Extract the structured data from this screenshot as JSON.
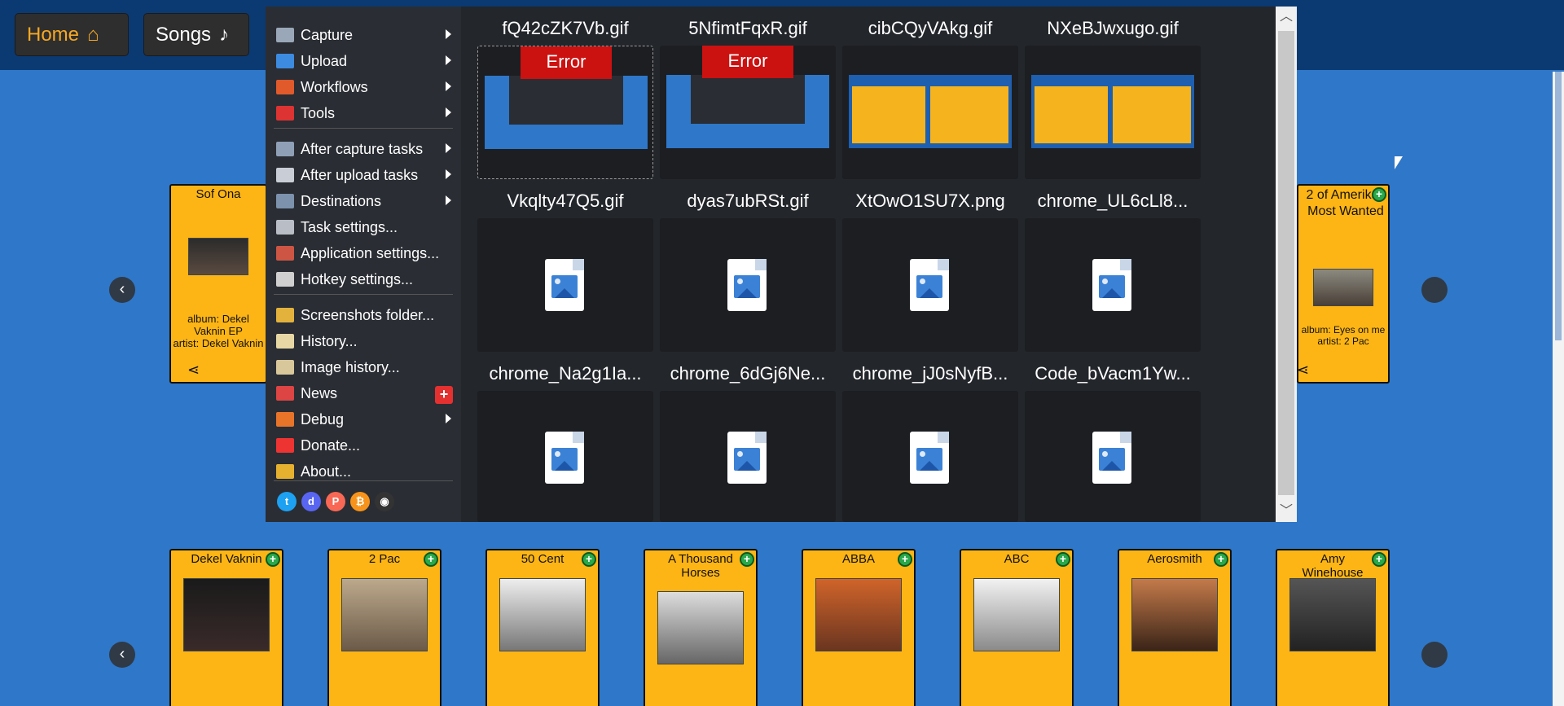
{
  "nav": {
    "home_label": "Home",
    "songs_label": "Songs",
    "home_icon": "home-icon",
    "songs_icon": "music-note-icon"
  },
  "row1": [
    {
      "title": "Sof Ona",
      "album": "album:  Dekel Vaknin EP",
      "artist": "artist: Dekel Vaknin"
    },
    {
      "title": "2 of Amerikaz Most Wanted",
      "album": "album:  Eyes on me",
      "artist": "artist: 2 Pac"
    }
  ],
  "row2": [
    {
      "title": "Dekel Vaknin"
    },
    {
      "title": "2 Pac"
    },
    {
      "title": "50 Cent"
    },
    {
      "title": "A Thousand Horses"
    },
    {
      "title": "ABBA"
    },
    {
      "title": "ABC"
    },
    {
      "title": "Aerosmith"
    },
    {
      "title": "Amy Winehouse"
    }
  ],
  "menu": [
    {
      "label": "Capture",
      "icon": "capture-icon",
      "color": "#9aa7b8",
      "submenu": true
    },
    {
      "label": "Upload",
      "icon": "upload-icon",
      "color": "#3d8be0",
      "submenu": true
    },
    {
      "label": "Workflows",
      "icon": "workflows-icon",
      "color": "#e05a2b",
      "submenu": true
    },
    {
      "label": "Tools",
      "icon": "tools-icon",
      "color": "#d33",
      "submenu": true
    },
    {
      "label": "After capture tasks",
      "icon": "after-capture-icon",
      "color": "#8fa0b6",
      "submenu": true
    },
    {
      "label": "After upload tasks",
      "icon": "after-upload-icon",
      "color": "#c9ced6",
      "submenu": true
    },
    {
      "label": "Destinations",
      "icon": "destinations-icon",
      "color": "#7c92ad",
      "submenu": true
    },
    {
      "label": "Task settings...",
      "icon": "gear-icon",
      "color": "#b9bec6",
      "submenu": false
    },
    {
      "label": "Application settings...",
      "icon": "wrench-icon",
      "color": "#c54",
      "submenu": false
    },
    {
      "label": "Hotkey settings...",
      "icon": "keyboard-icon",
      "color": "#d0d0d0",
      "submenu": false
    },
    {
      "label": "Screenshots folder...",
      "icon": "folder-icon",
      "color": "#e3b23c",
      "submenu": false
    },
    {
      "label": "History...",
      "icon": "history-icon",
      "color": "#e7d7a5",
      "submenu": false
    },
    {
      "label": "Image history...",
      "icon": "image-history-icon",
      "color": "#d8c79a",
      "submenu": false
    },
    {
      "label": "News",
      "icon": "megaphone-icon",
      "color": "#d44",
      "submenu": false
    },
    {
      "label": "Debug",
      "icon": "cone-icon",
      "color": "#e8742a",
      "submenu": true
    },
    {
      "label": "Donate...",
      "icon": "heart-icon",
      "color": "#e33",
      "submenu": false
    },
    {
      "label": "About...",
      "icon": "crown-icon",
      "color": "#e6b12f",
      "submenu": false
    }
  ],
  "news_badge": "+",
  "social": [
    {
      "icon": "twitter-icon",
      "glyph": "t",
      "color": "#1da1f2"
    },
    {
      "icon": "discord-icon",
      "glyph": "d",
      "color": "#5865f2"
    },
    {
      "icon": "patreon-icon",
      "glyph": "P",
      "color": "#f96854"
    },
    {
      "icon": "bitcoin-icon",
      "glyph": "₿",
      "color": "#f7931a"
    },
    {
      "icon": "github-icon",
      "glyph": "◉",
      "color": "#333"
    }
  ],
  "files": [
    {
      "name": "fQ42cZK7Vb.gif",
      "preview": "error",
      "error": "Error"
    },
    {
      "name": "5NfimtFqxR.gif",
      "preview": "error",
      "error": "Error"
    },
    {
      "name": "cibCQyVAkg.gif",
      "preview": "chart"
    },
    {
      "name": "NXeBJwxugo.gif",
      "preview": "chart"
    },
    {
      "name": "Vkqlty47Q5.gif",
      "preview": "file"
    },
    {
      "name": "dyas7ubRSt.gif",
      "preview": "file"
    },
    {
      "name": "XtOwO1SU7X.png",
      "preview": "file"
    },
    {
      "name": "chrome_UL6cLl8...",
      "preview": "file"
    },
    {
      "name": "chrome_Na2g1Ia...",
      "preview": "file"
    },
    {
      "name": "chrome_6dGj6Ne...",
      "preview": "file"
    },
    {
      "name": "chrome_jJ0sNyfB...",
      "preview": "file"
    },
    {
      "name": "Code_bVacm1Yw...",
      "preview": "file"
    }
  ],
  "colors": {
    "page_bg": "#2f77c8",
    "card": "#fdb515",
    "popup": "#23262b",
    "error": "#cc1111"
  }
}
